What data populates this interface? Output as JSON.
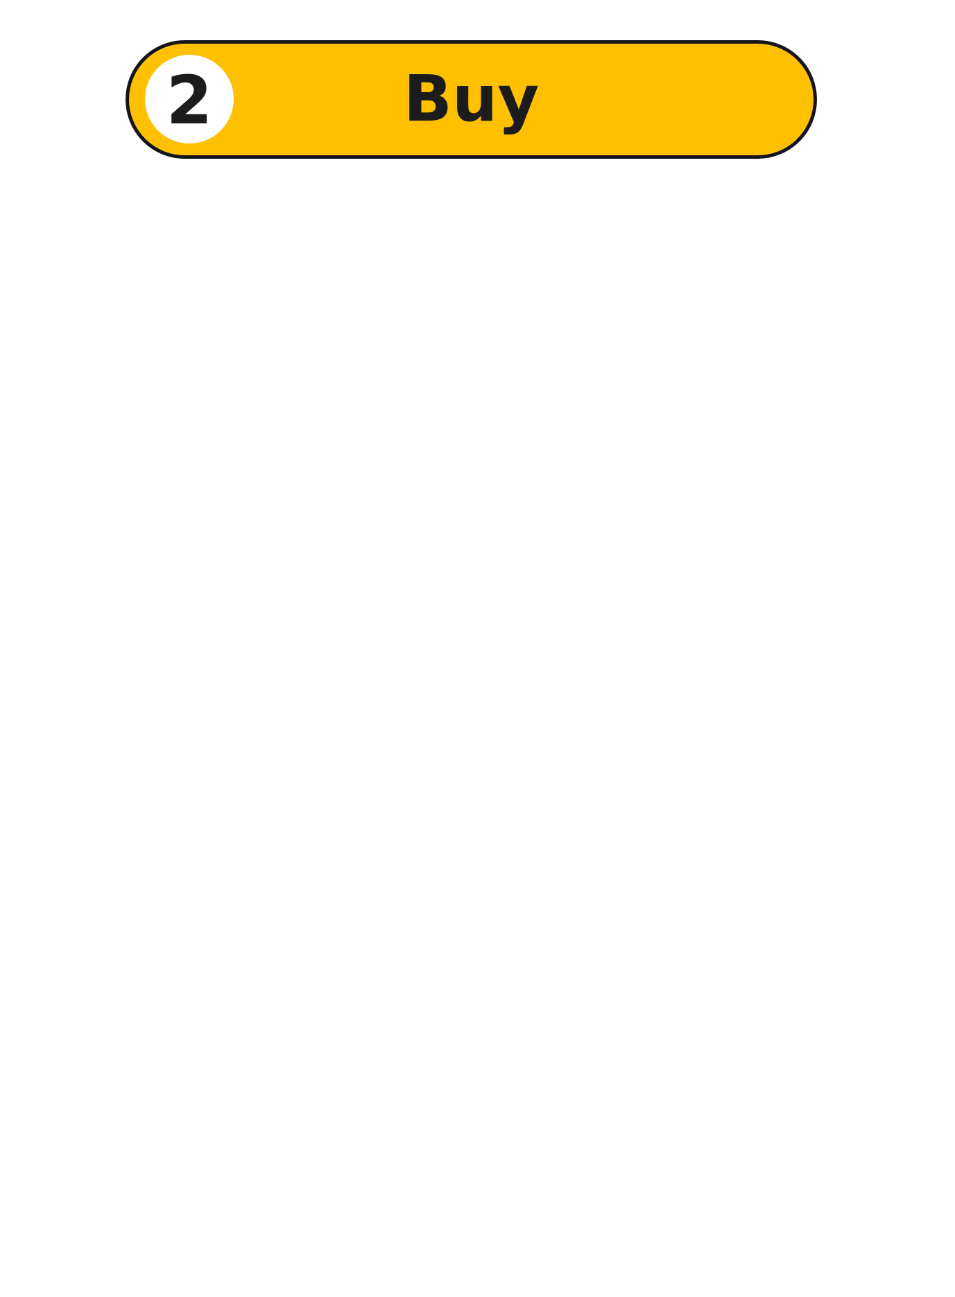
{
  "step": {
    "number": "2",
    "label": "Buy"
  },
  "colors": {
    "pill_background": "#ffc000",
    "pill_border": "#14141e",
    "badge_background": "#ffffff",
    "text": "#1c1c1c",
    "page_background": "#ffffff"
  }
}
